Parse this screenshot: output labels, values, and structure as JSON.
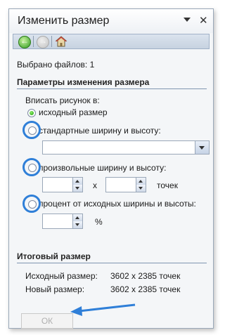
{
  "window": {
    "title": "Изменить размер",
    "close_glyph": "✕"
  },
  "toolbar": {
    "back_icon": "back-arrow",
    "forward_icon": "forward-arrow",
    "home_icon": "home"
  },
  "selected_files": "Выбрано файлов: 1",
  "params": {
    "heading": "Параметры изменения размера",
    "fit_label": "Вписать рисунок в:",
    "options": [
      {
        "label": "исходный размер",
        "selected": true
      },
      {
        "label": "стандартные ширину и высоту:",
        "selected": false
      },
      {
        "label": "произвольные ширину и высоту:",
        "selected": false
      },
      {
        "label": "процент от исходных ширины и высоты:",
        "selected": false
      }
    ],
    "standard_size_value": "",
    "custom": {
      "width": "",
      "height": "",
      "separator": "x",
      "unit": "точек"
    },
    "percent": {
      "value": "",
      "unit": "%"
    }
  },
  "result": {
    "heading": "Итоговый размер",
    "original_label": "Исходный размер:",
    "original_value": "3602 x 2385 точек",
    "new_label": "Новый размер:",
    "new_value": "3602 x 2385 точек"
  },
  "ok_label": "ОК",
  "colors": {
    "highlight": "#2f7fd8",
    "selected_radio": "#1d9a0d",
    "section_rule": "#7f95b0"
  }
}
